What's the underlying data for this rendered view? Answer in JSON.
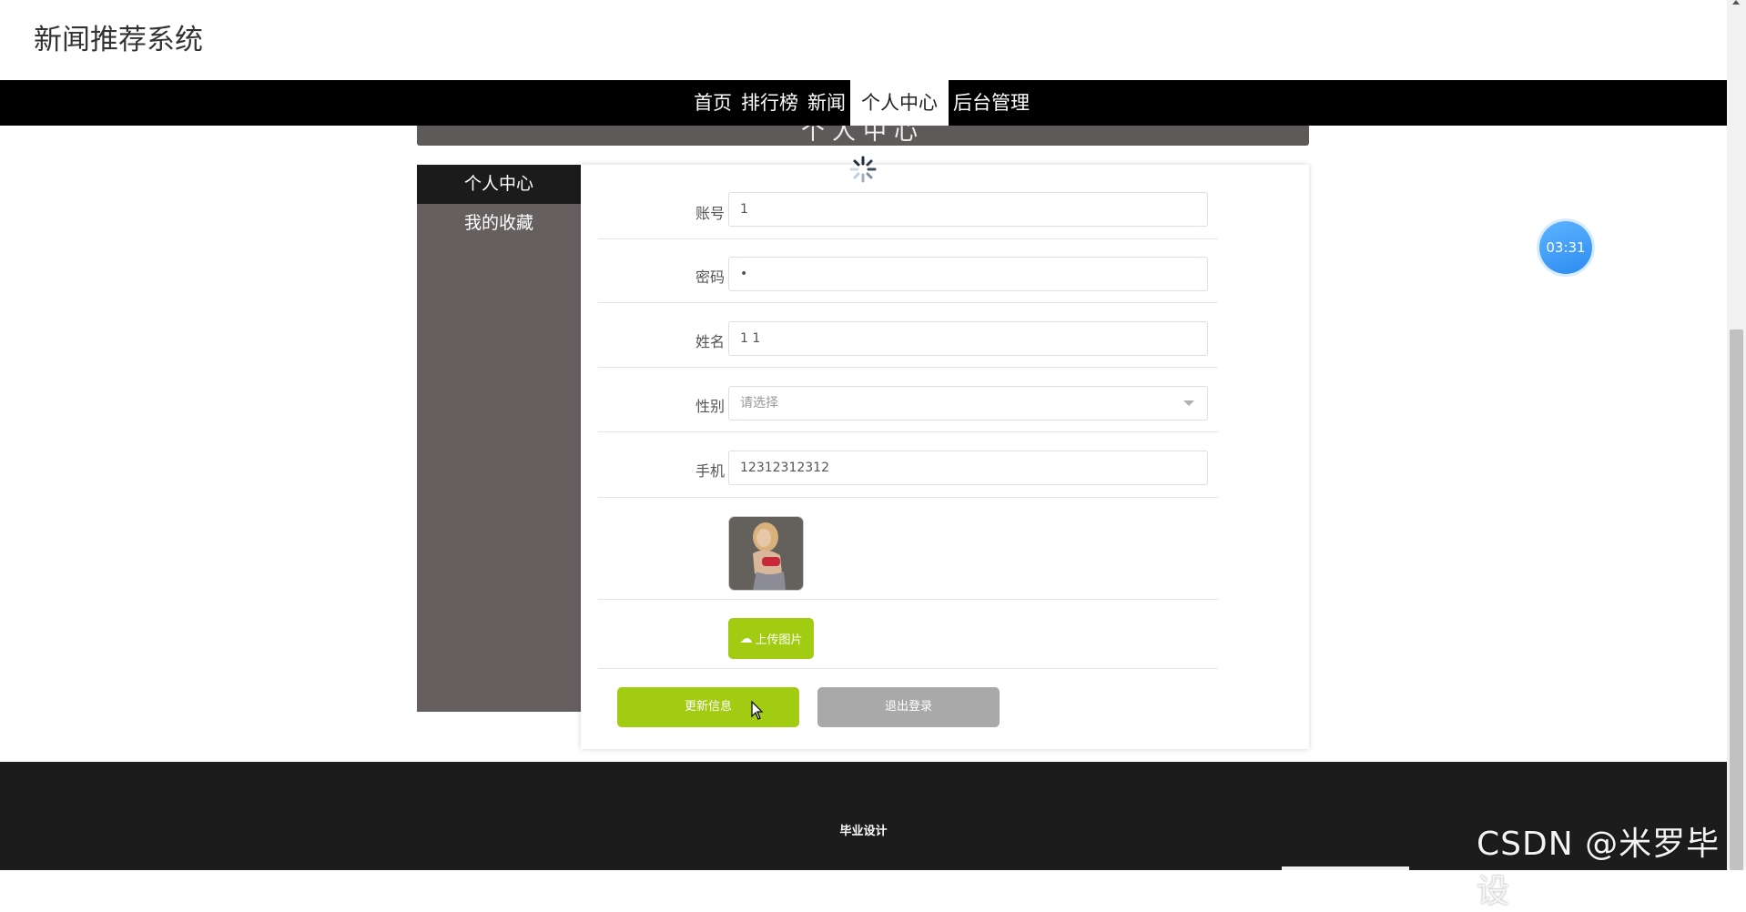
{
  "header": {
    "site_title": "新闻推荐系统"
  },
  "nav": {
    "items": [
      {
        "label": "首页"
      },
      {
        "label": "排行榜"
      },
      {
        "label": "新闻"
      },
      {
        "label": "个人中心"
      },
      {
        "label": "后台管理"
      }
    ],
    "active": "个人中心"
  },
  "banner": {
    "title": "个人中心"
  },
  "sidebar": {
    "items": [
      {
        "label": "个人中心"
      },
      {
        "label": "我的收藏"
      }
    ]
  },
  "form": {
    "account": {
      "label": "账号",
      "value": "1"
    },
    "password": {
      "label": "密码",
      "value": "•"
    },
    "name": {
      "label": "姓名",
      "value": "1 1"
    },
    "gender": {
      "label": "性别",
      "placeholder": "请选择"
    },
    "phone": {
      "label": "手机",
      "value": "12312312312"
    },
    "upload_label": "上传图片",
    "update_label": "更新信息",
    "logout_label": "退出登录"
  },
  "timer": {
    "text": "03:31"
  },
  "footer": {
    "text": "毕业设计"
  },
  "watermark": {
    "text": "CSDN @米罗毕设"
  },
  "colors": {
    "accent_green": "#a2cc12",
    "nav_bg": "#000000",
    "sidebar_bg": "#665f60",
    "footer_bg": "#1c1c1c"
  }
}
